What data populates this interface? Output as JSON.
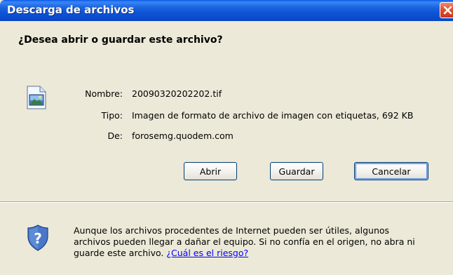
{
  "window": {
    "title": "Descarga de archivos",
    "close_icon": "close-icon"
  },
  "question": "¿Desea abrir o guardar este archivo?",
  "file": {
    "icon": "image-file-icon",
    "name_label": "Nombre:",
    "name": "20090320202202.tif",
    "type_label": "Tipo:",
    "type": "Imagen de formato de archivo de imagen con etiquetas, 692 KB",
    "from_label": "De:",
    "from": "forosemg.quodem.com"
  },
  "buttons": {
    "open": "Abrir",
    "save": "Guardar",
    "cancel": "Cancelar"
  },
  "warning": {
    "icon": "shield-question-icon",
    "text": "Aunque los archivos procedentes de Internet pueden ser útiles, algunos archivos pueden llegar a dañar el equipo. Si no confía en el origen, no abra ni guarde este archivo.",
    "link": "¿Cuál es el riesgo?"
  },
  "colors": {
    "titlebar": "#0b4bcc",
    "close_button": "#e0512f",
    "dialog_background": "#ece9d8",
    "link": "#0000ff"
  }
}
